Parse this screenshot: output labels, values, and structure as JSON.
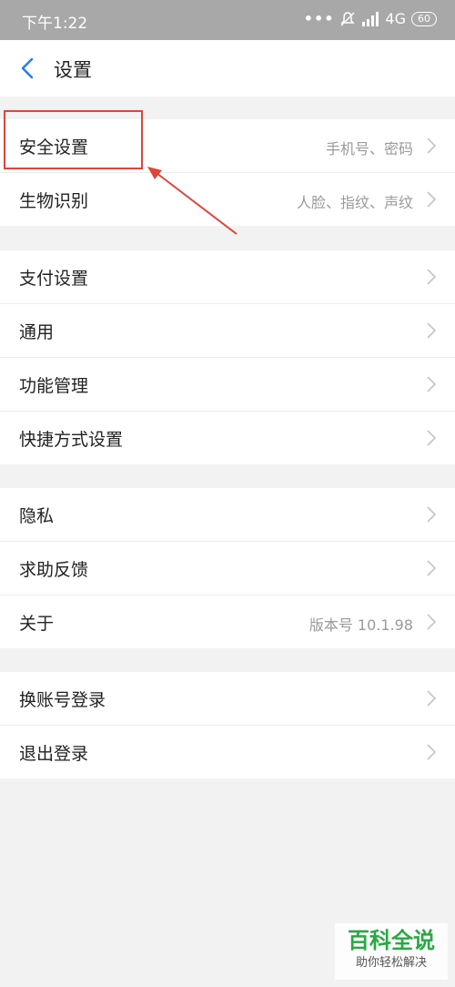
{
  "status_bar": {
    "time": "下午1:22",
    "dots": "•••",
    "network": "4G",
    "battery": "60"
  },
  "header": {
    "title": "设置"
  },
  "groups": [
    {
      "items": [
        {
          "label": "安全设置",
          "value": "手机号、密码"
        },
        {
          "label": "生物识别",
          "value": "人脸、指纹、声纹"
        }
      ]
    },
    {
      "items": [
        {
          "label": "支付设置",
          "value": ""
        },
        {
          "label": "通用",
          "value": ""
        },
        {
          "label": "功能管理",
          "value": ""
        },
        {
          "label": "快捷方式设置",
          "value": ""
        }
      ]
    },
    {
      "items": [
        {
          "label": "隐私",
          "value": ""
        },
        {
          "label": "求助反馈",
          "value": ""
        },
        {
          "label": "关于",
          "value": "版本号 10.1.98"
        }
      ]
    },
    {
      "items": [
        {
          "label": "换账号登录",
          "value": ""
        },
        {
          "label": "退出登录",
          "value": ""
        }
      ]
    }
  ],
  "annotation": {
    "color": "#e0443a"
  },
  "watermark": {
    "title": "百科全说",
    "subtitle": "助你轻松解决"
  },
  "colors": {
    "accent": "#2a7fe0",
    "watermark_green": "#2aa843"
  }
}
